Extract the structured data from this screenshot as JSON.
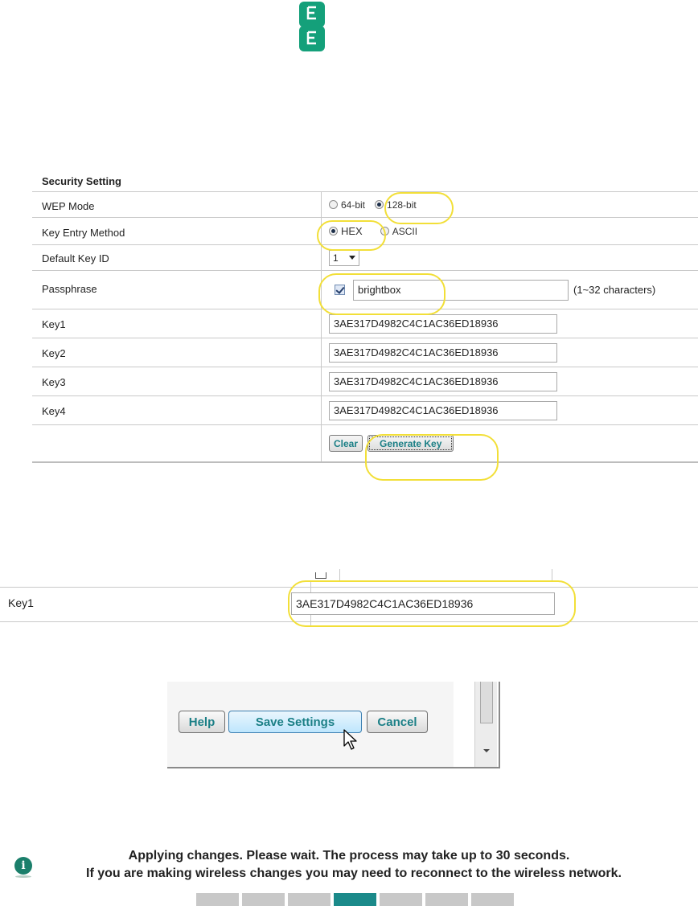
{
  "security": {
    "title": "Security Setting",
    "wep_mode": {
      "label": "WEP Mode",
      "options": [
        "64-bit",
        "128-bit"
      ],
      "selected": "128-bit"
    },
    "key_entry": {
      "label": "Key Entry Method",
      "options": [
        "HEX",
        "ASCII"
      ],
      "selected": "HEX"
    },
    "default_key": {
      "label": "Default Key ID",
      "value": "1"
    },
    "passphrase": {
      "label": "Passphrase",
      "value": "brightbox",
      "checked": true,
      "hint": "(1~32 characters)"
    },
    "keys": [
      {
        "label": "Key1",
        "value": "3AE317D4982C4C1AC36ED18936"
      },
      {
        "label": "Key2",
        "value": "3AE317D4982C4C1AC36ED18936"
      },
      {
        "label": "Key3",
        "value": "3AE317D4982C4C1AC36ED18936"
      },
      {
        "label": "Key4",
        "value": "3AE317D4982C4C1AC36ED18936"
      }
    ],
    "buttons": {
      "clear": "Clear",
      "generate": "Generate Key"
    }
  },
  "zoom": {
    "label": "Key1",
    "value": "3AE317D4982C4C1AC36ED18936"
  },
  "dialog": {
    "help": "Help",
    "save": "Save Settings",
    "cancel": "Cancel"
  },
  "notice": {
    "line1": "Applying changes. Please wait. The process may take up to 30 seconds.",
    "line2": "If you are making wireless changes you may need to reconnect to the wireless network.",
    "progress": {
      "segments": 7,
      "active": 4
    }
  },
  "colors": {
    "brand": "#1b8a6b",
    "highlight": "#f2df38",
    "button_text": "#1b7f86"
  }
}
